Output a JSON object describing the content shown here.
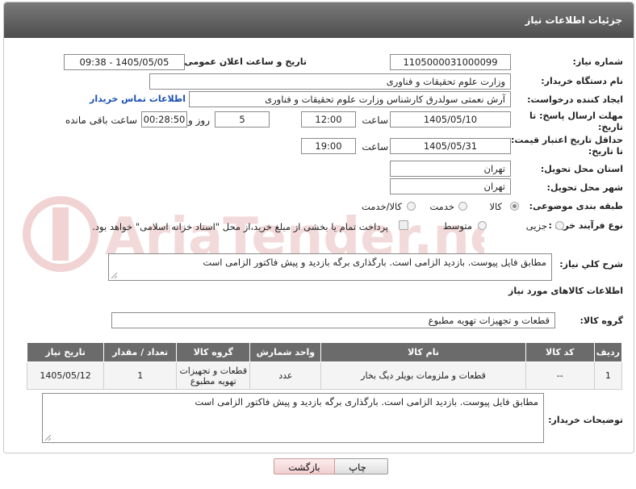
{
  "page": {
    "title": "جزئیات اطلاعات نیاز"
  },
  "watermark": {
    "text": "AriaTender.neT"
  },
  "form": {
    "need_number": {
      "label": "شماره نیاز:",
      "value": "1105000031000099"
    },
    "announce_datetime": {
      "label": "تاریخ و ساعت اعلان عمومی:",
      "value": "1405/05/05 - 09:38"
    },
    "buyer_org": {
      "label": "نام دستگاه خریدار:",
      "value": "وزارت علوم  تحقیقات و فناوری"
    },
    "requester": {
      "label": "ایجاد کننده درخواست:",
      "value": "آرش نعمتی سولدرق کارشناس وزارت علوم  تحقیقات و فناوری",
      "contact_link": "اطلاعات تماس خریدار"
    },
    "reply_deadline": {
      "label_line1": "مهلت ارسال پاسخ: تا",
      "label_line2": "تاریخ:",
      "date": "1405/05/10",
      "time_label": "ساعت",
      "time": "12:00",
      "days": "5",
      "days_label": "روز و",
      "remaining": "00:28:50",
      "remaining_label": "ساعت باقی مانده"
    },
    "price_validity": {
      "label_line1": "حداقل تاریخ اعتبار قیمت:",
      "label_line2": "تا تاریخ:",
      "date": "1405/05/31",
      "time_label": "ساعت",
      "time": "19:00"
    },
    "delivery_province": {
      "label": "استان محل تحویل:",
      "value": "تهران"
    },
    "delivery_city": {
      "label": "شهر محل تحویل:",
      "value": "تهران"
    },
    "category": {
      "label": "طبقه بندی موضوعی:",
      "options": [
        "کالا",
        "خدمت",
        "کالا/خدمت"
      ],
      "selected": "کالا"
    },
    "process_type": {
      "label": "نوع فرآیند خرید :",
      "options": [
        "جزیی",
        "متوسط"
      ],
      "payment_note": "پرداخت تمام یا بخشی از مبلغ خرید،از محل \"اسناد خزانه اسلامی\" خواهد بود."
    },
    "description": {
      "label": "شرح کلي نياز:",
      "value": "مطابق فایل پیوست. بازدید الزامی است. بارگذاری برگه بازدید و پیش فاکتور الزامی است"
    }
  },
  "goods": {
    "section_title": "اطلاعات کالاهای مورد نیاز",
    "group_label": "گروه کالا:",
    "group_value": "قطعات و تجهیزات تهویه مطبوع",
    "columns": [
      "ردیف",
      "کد کالا",
      "نام کالا",
      "واحد شمارش",
      "گروه کالا",
      "تعداد / مقدار",
      "تاریخ نیاز"
    ],
    "rows": [
      {
        "row": "1",
        "code": "--",
        "name": "قطعات و ملزومات بویلر دیگ بخار",
        "unit": "عدد",
        "group": "قطعات و تجهیزات تهویه مطبوع",
        "qty": "1",
        "date": "1405/05/12"
      }
    ]
  },
  "buyer_notes": {
    "label": "توضیحات خریدار:",
    "value": "مطابق فایل پیوست. بازدید الزامی است. بارگذاری برگه بازدید و پیش فاکتور الزامی است"
  },
  "buttons": {
    "print": "چاپ",
    "back": "بازگشت"
  },
  "colors": {
    "header": "#5a5a5a",
    "link": "#1a4fb5",
    "watermark": "#f2d4d4"
  }
}
